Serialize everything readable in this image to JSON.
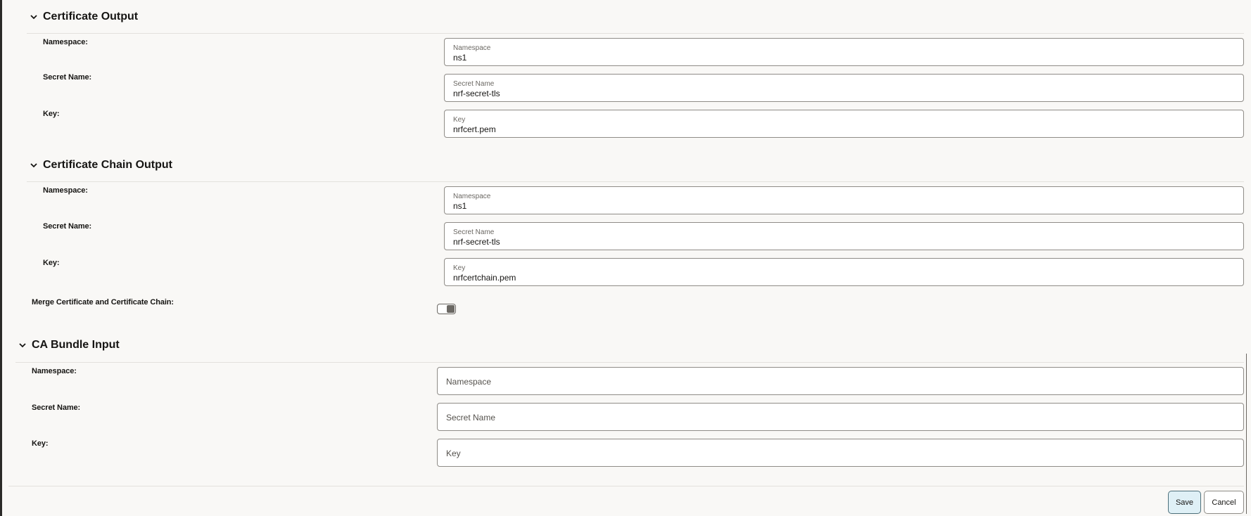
{
  "sections": {
    "cert_output": {
      "title": "Certificate Output",
      "namespace": {
        "label": "Namespace:",
        "field_label": "Namespace",
        "value": "ns1"
      },
      "secret_name": {
        "label": "Secret Name:",
        "field_label": "Secret Name",
        "value": "nrf-secret-tls"
      },
      "key": {
        "label": "Key:",
        "field_label": "Key",
        "value": "nrfcert.pem"
      }
    },
    "chain_output": {
      "title": "Certificate Chain Output",
      "namespace": {
        "label": "Namespace:",
        "field_label": "Namespace",
        "value": "ns1"
      },
      "secret_name": {
        "label": "Secret Name:",
        "field_label": "Secret Name",
        "value": "nrf-secret-tls"
      },
      "key": {
        "label": "Key:",
        "field_label": "Key",
        "value": "nrfcertchain.pem"
      }
    },
    "merge": {
      "label": "Merge Certificate and Certificate Chain:",
      "enabled": false
    },
    "ca_bundle": {
      "title": "CA Bundle Input",
      "namespace": {
        "label": "Namespace:",
        "placeholder": "Namespace"
      },
      "secret_name": {
        "label": "Secret Name:",
        "placeholder": "Secret Name"
      },
      "key": {
        "label": "Key:",
        "placeholder": "Key"
      }
    }
  },
  "footer": {
    "save_label": "Save",
    "cancel_label": "Cancel"
  },
  "icons": {
    "section_toggle": "chevron-down-icon"
  }
}
